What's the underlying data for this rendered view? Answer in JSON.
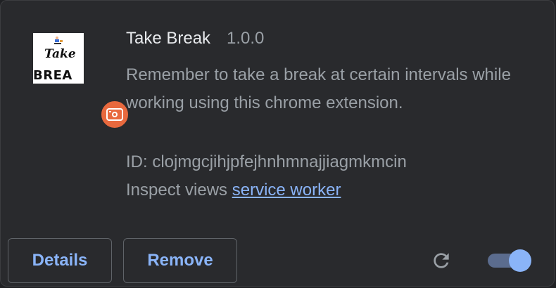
{
  "extension": {
    "name": "Take Break",
    "version": "1.0.0",
    "description": "Remember to take a break at certain intervals while working using this chrome extension.",
    "id_label": "ID: clojmgcjihjpfejhnhmnajjiagmkmcin",
    "inspect_label": "Inspect views",
    "inspect_link": "service worker",
    "logo_text_top": "Take",
    "logo_text_bottom": "BREA",
    "enabled": true
  },
  "buttons": {
    "details": "Details",
    "remove": "Remove"
  },
  "colors": {
    "background": "#292a2d",
    "accent": "#8ab4f8",
    "badge": "#e8693e"
  },
  "icons": {
    "reload": "reload-icon",
    "badge": "recorder-badge-icon"
  }
}
